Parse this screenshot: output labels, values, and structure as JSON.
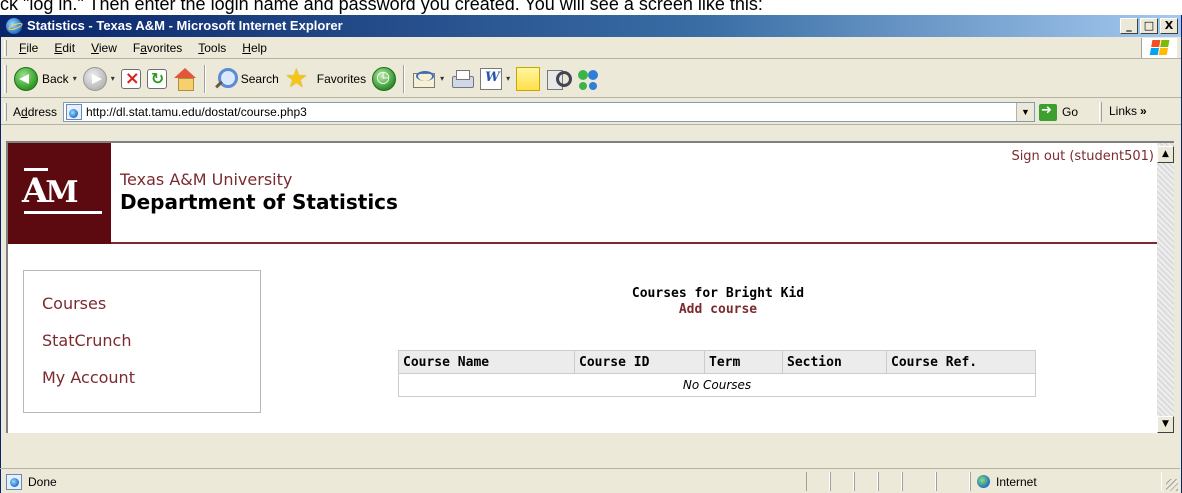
{
  "caption": "ck \"log in.\" Then enter the login name and password you created. You will see a screen like this:",
  "window": {
    "title": "Statistics - Texas A&M - Microsoft Internet Explorer",
    "controls": {
      "minimize": "_",
      "maximize": "□",
      "close": "X"
    }
  },
  "menu": {
    "items": [
      {
        "key": "F",
        "rest": "ile"
      },
      {
        "key": "E",
        "rest": "dit"
      },
      {
        "key": "V",
        "rest": "iew"
      },
      {
        "pre": "F",
        "key": "a",
        "rest": "vorites"
      },
      {
        "key": "T",
        "rest": "ools"
      },
      {
        "key": "H",
        "rest": "elp"
      }
    ]
  },
  "toolbar": {
    "back_label": "Back",
    "search_label": "Search",
    "favorites_label": "Favorites",
    "dropdown_glyph": "▾"
  },
  "address": {
    "label_key": "d",
    "label_pre": "A",
    "label_rest": "dress",
    "url": "http://dl.stat.tamu.edu/dostat/course.php3",
    "dropdown_glyph": "▼",
    "go_label": "Go",
    "links_label": "Links",
    "links_chevron": "»"
  },
  "page": {
    "logo": {
      "letters_a": "A",
      "letters_m": "M"
    },
    "university": "Texas A&M University",
    "department": "Department of Statistics",
    "signout": "Sign out (student501)",
    "nav": [
      {
        "label": "Courses"
      },
      {
        "label": "StatCrunch"
      },
      {
        "label": "My Account"
      }
    ],
    "courses_title": "Courses for Bright Kid",
    "add_course": "Add course",
    "table": {
      "columns": [
        "Course Name",
        "Course ID",
        "Term",
        "Section",
        "Course Ref."
      ],
      "empty_message": "No Courses"
    }
  },
  "scrollbar": {
    "up": "▲",
    "down": "▼"
  },
  "status": {
    "text": "Done",
    "zone": "Internet"
  }
}
